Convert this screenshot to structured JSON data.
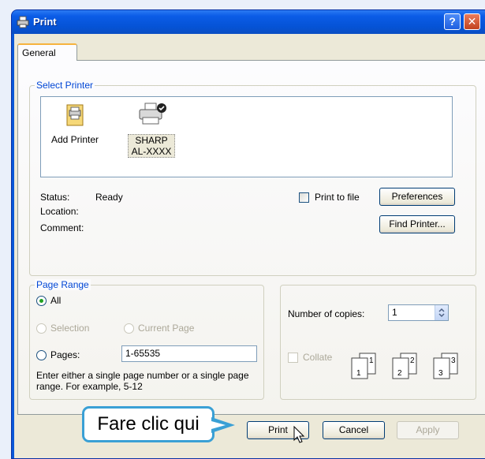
{
  "window": {
    "title": "Print",
    "help_symbol": "?",
    "close_symbol": "✕",
    "icon": "printer-icon"
  },
  "tabs": [
    {
      "label": "General",
      "active": true
    }
  ],
  "select_printer": {
    "legend": "Select Printer",
    "printers": [
      {
        "label": "Add Printer",
        "icon": "add-printer-icon"
      },
      {
        "label_line1": "SHARP",
        "label_line2": "AL-XXXX",
        "icon": "printer-default-icon",
        "selected": true
      }
    ],
    "status_label": "Status:",
    "status_value": "Ready",
    "location_label": "Location:",
    "comment_label": "Comment:",
    "print_to_file_label": "Print to file",
    "print_to_file_checked": false,
    "preferences_label": "Preferences",
    "find_printer_label": "Find Printer..."
  },
  "page_range": {
    "legend": "Page Range",
    "all_label": "All",
    "all_selected": true,
    "selection_label": "Selection",
    "current_page_label": "Current Page",
    "pages_label": "Pages:",
    "pages_value": "1-65535",
    "hint": "Enter either a single page number or a single page range.  For example, 5-12"
  },
  "copies": {
    "number_label": "Number of copies:",
    "number_value": "1",
    "collate_label": "Collate",
    "collate_checked": false
  },
  "footer": {
    "print_label": "Print",
    "cancel_label": "Cancel",
    "apply_label": "Apply"
  },
  "callout": {
    "text": "Fare clic qui"
  },
  "colors": {
    "accent": "#0a58d8",
    "group_title": "#0046d5",
    "callout_border": "#3aa0d5"
  }
}
